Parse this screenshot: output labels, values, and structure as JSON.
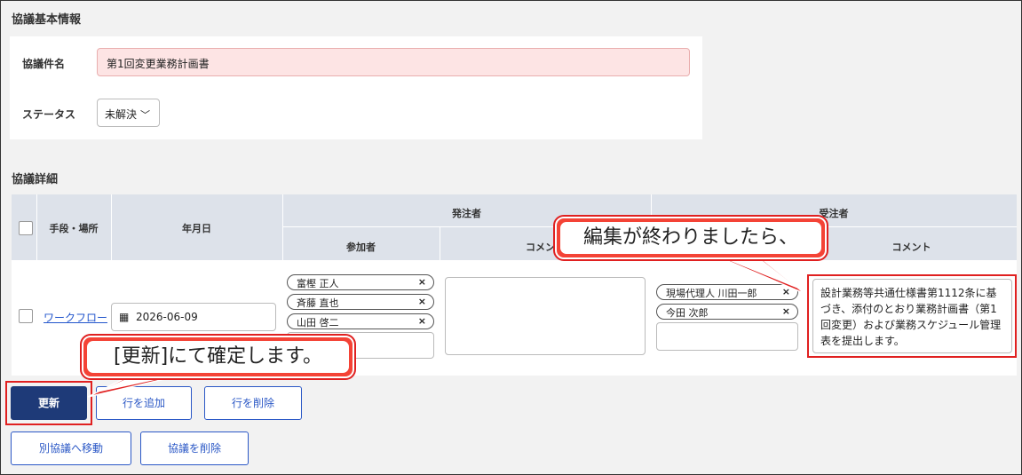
{
  "basic_section": {
    "title": "協議基本情報",
    "name_label": "協議件名",
    "name_value": "第1回変更業務計画書",
    "status_label": "ステータス",
    "status_value": "未解決"
  },
  "detail_section": {
    "title": "協議詳細",
    "headers": {
      "method": "手段・場所",
      "date": "年月日",
      "orderer": "発注者",
      "orderer_participants": "参加者",
      "orderer_comment": "コメント",
      "contractor": "受注者",
      "contractor_comment": "コメント"
    },
    "row": {
      "method_link": "ワークフロー",
      "date": "2026-06-09",
      "orderer_participants": [
        "富樫 正人",
        "斉藤 直也",
        "山田 啓二"
      ],
      "contractor_participants": [
        "現場代理人 川田一郎",
        "今田 次郎"
      ],
      "contractor_comment": "設計業務等共通仕様書第1112条に基づき、添付のとおり業務計画書（第1回変更）および業務スケジュール管理表を提出します。"
    }
  },
  "buttons": {
    "update": "更新",
    "add_row": "行を追加",
    "delete_row": "行を削除",
    "move": "別協議へ移動",
    "delete_discussion": "協議を削除"
  },
  "callouts": {
    "edit_done": "編集が終わりましたら、",
    "confirm": "[更新]にて確定します。"
  },
  "colors": {
    "accent": "#e02020",
    "primary_button": "#1e3a78",
    "link": "#2255cc",
    "header_bg": "#dde2ea",
    "required_input_bg": "#fde4e4"
  }
}
